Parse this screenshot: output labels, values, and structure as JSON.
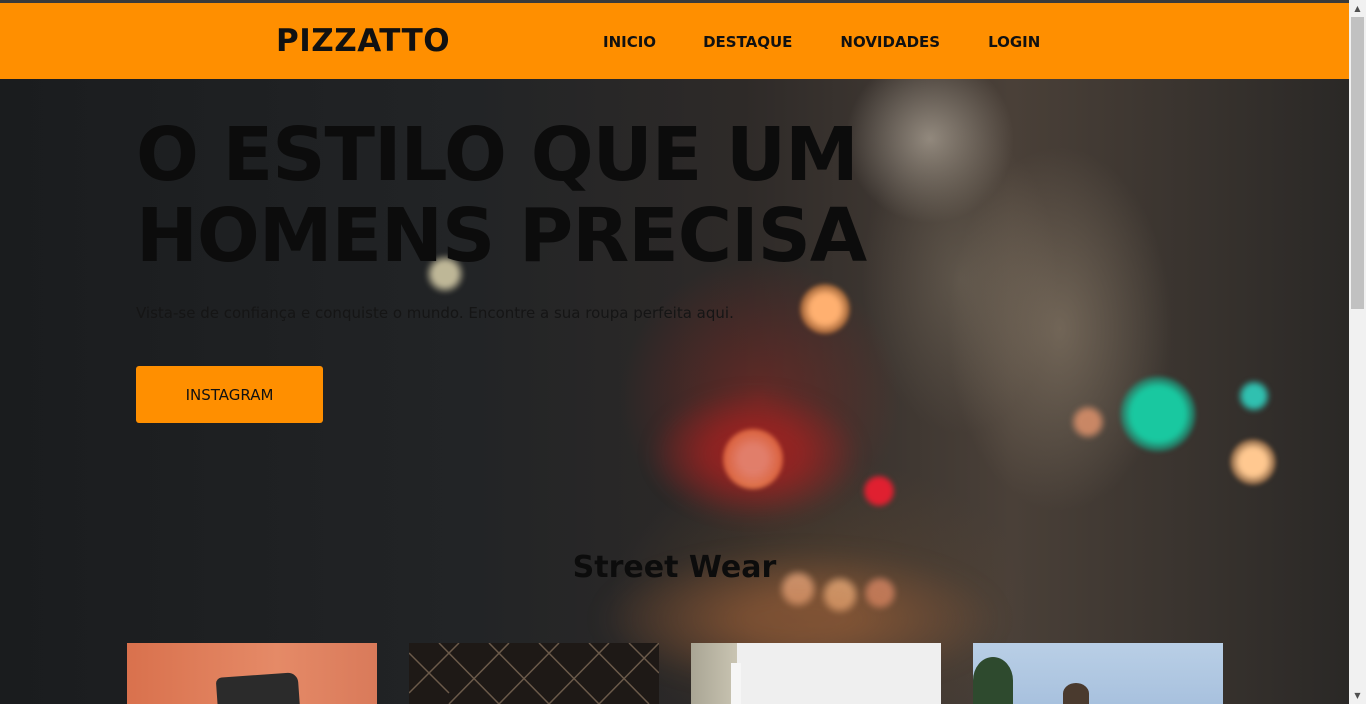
{
  "header": {
    "brand": "PIZZATTO",
    "nav": [
      "INICIO",
      "DESTAQUE",
      "NOVIDADES",
      "LOGIN"
    ]
  },
  "hero": {
    "title_line1": "O ESTILO QUE UM",
    "title_line2": "HOMENS PRECISA",
    "subtitle": "Vista-se de confiança e conquiste o mundo. Encontre a sua roupa perfeita aqui.",
    "cta_label": "INSTAGRAM"
  },
  "section": {
    "title": "Street Wear"
  },
  "colors": {
    "accent": "#ff8f00",
    "text_dark": "#0c0c0c"
  },
  "icons": {
    "scroll_up": "triangle-up",
    "scroll_down": "triangle-down"
  }
}
